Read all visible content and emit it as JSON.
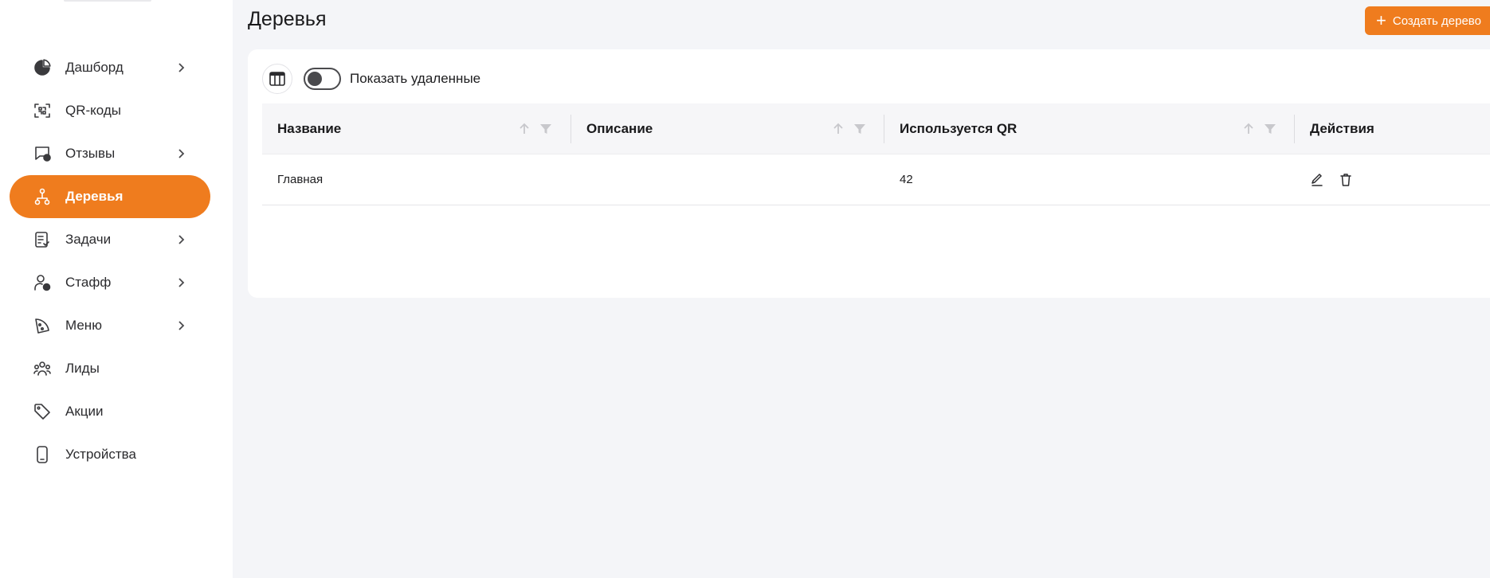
{
  "sidebar": {
    "items": [
      {
        "label": "Дашборд",
        "icon": "pie-chart-icon",
        "has_chevron": true,
        "active": false
      },
      {
        "label": "QR-коды",
        "icon": "qr-scan-icon",
        "has_chevron": false,
        "active": false
      },
      {
        "label": "Отзывы",
        "icon": "reviews-icon",
        "has_chevron": true,
        "active": false
      },
      {
        "label": "Деревья",
        "icon": "tree-icon",
        "has_chevron": false,
        "active": true
      },
      {
        "label": "Задачи",
        "icon": "tasks-icon",
        "has_chevron": true,
        "active": false
      },
      {
        "label": "Стафф",
        "icon": "staff-icon",
        "has_chevron": true,
        "active": false
      },
      {
        "label": "Меню",
        "icon": "menu-icon",
        "has_chevron": true,
        "active": false
      },
      {
        "label": "Лиды",
        "icon": "leads-icon",
        "has_chevron": false,
        "active": false
      },
      {
        "label": "Акции",
        "icon": "tag-icon",
        "has_chevron": false,
        "active": false
      },
      {
        "label": "Устройства",
        "icon": "device-icon",
        "has_chevron": false,
        "active": false
      }
    ]
  },
  "header": {
    "title": "Деревья",
    "create_button_label": "Создать дерево"
  },
  "toolbar": {
    "show_deleted_label": "Показать удаленные",
    "show_deleted_on": false
  },
  "table": {
    "columns": [
      "Название",
      "Описание",
      "Используется QR",
      "Действия"
    ],
    "rows": [
      {
        "name": "Главная",
        "description": "",
        "qr_count": "42"
      }
    ]
  },
  "colors": {
    "accent": "#ef7c1e",
    "background": "#f4f5f8",
    "card": "#ffffff",
    "header_row": "#f6f6f8"
  }
}
